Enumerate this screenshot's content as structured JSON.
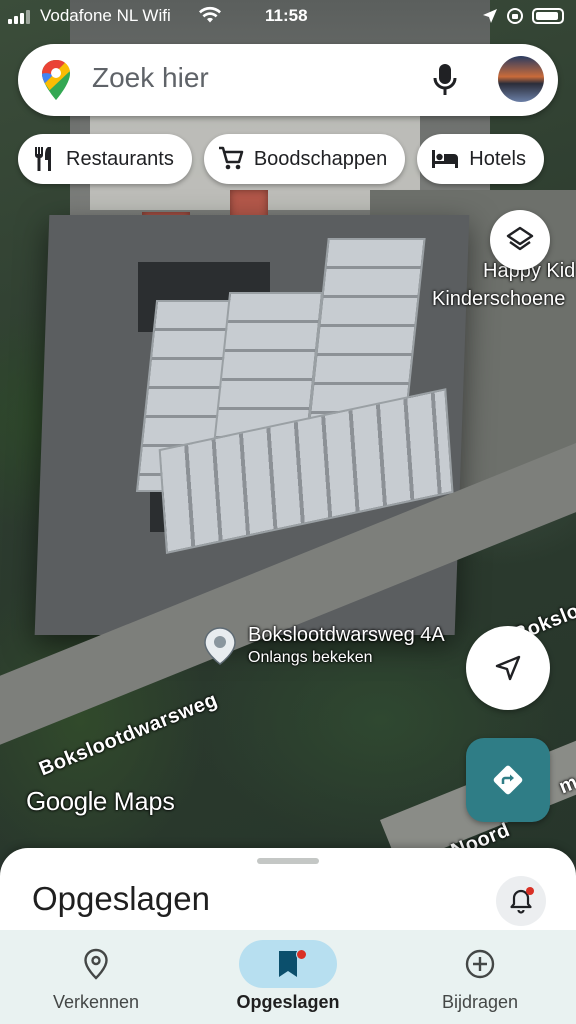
{
  "status_bar": {
    "carrier": "Vodafone NL Wifi",
    "time": "11:58"
  },
  "search": {
    "placeholder": "Zoek hier"
  },
  "chips": [
    {
      "label": "Restaurants",
      "icon": "fork-knife-icon"
    },
    {
      "label": "Boodschappen",
      "icon": "cart-icon"
    },
    {
      "label": "Hotels",
      "icon": "bed-icon"
    }
  ],
  "map": {
    "place_label_line1": "Happy Kid",
    "place_label_line2": "Kinderschoene",
    "road_label_main": "Bokslootdwarsweg",
    "road_label_top": "Bokslo",
    "road_label_bottom": "Noord",
    "road_label_side": "m",
    "pin_title": "Bokslootdwarsweg 4A",
    "pin_subtitle": "Onlangs bekeken",
    "watermark_google": "Google",
    "watermark_maps": "Maps"
  },
  "sheet": {
    "title": "Opgeslagen"
  },
  "nav": {
    "items": [
      {
        "label": "Verkennen",
        "icon": "location-pin-icon",
        "active": false
      },
      {
        "label": "Opgeslagen",
        "icon": "bookmark-icon",
        "active": true
      },
      {
        "label": "Bijdragen",
        "icon": "add-circle-icon",
        "active": false
      }
    ]
  },
  "colors": {
    "accent_teal": "#2f7d86",
    "active_nav_bg": "#b7dff0",
    "notification_dot": "#d93025"
  }
}
